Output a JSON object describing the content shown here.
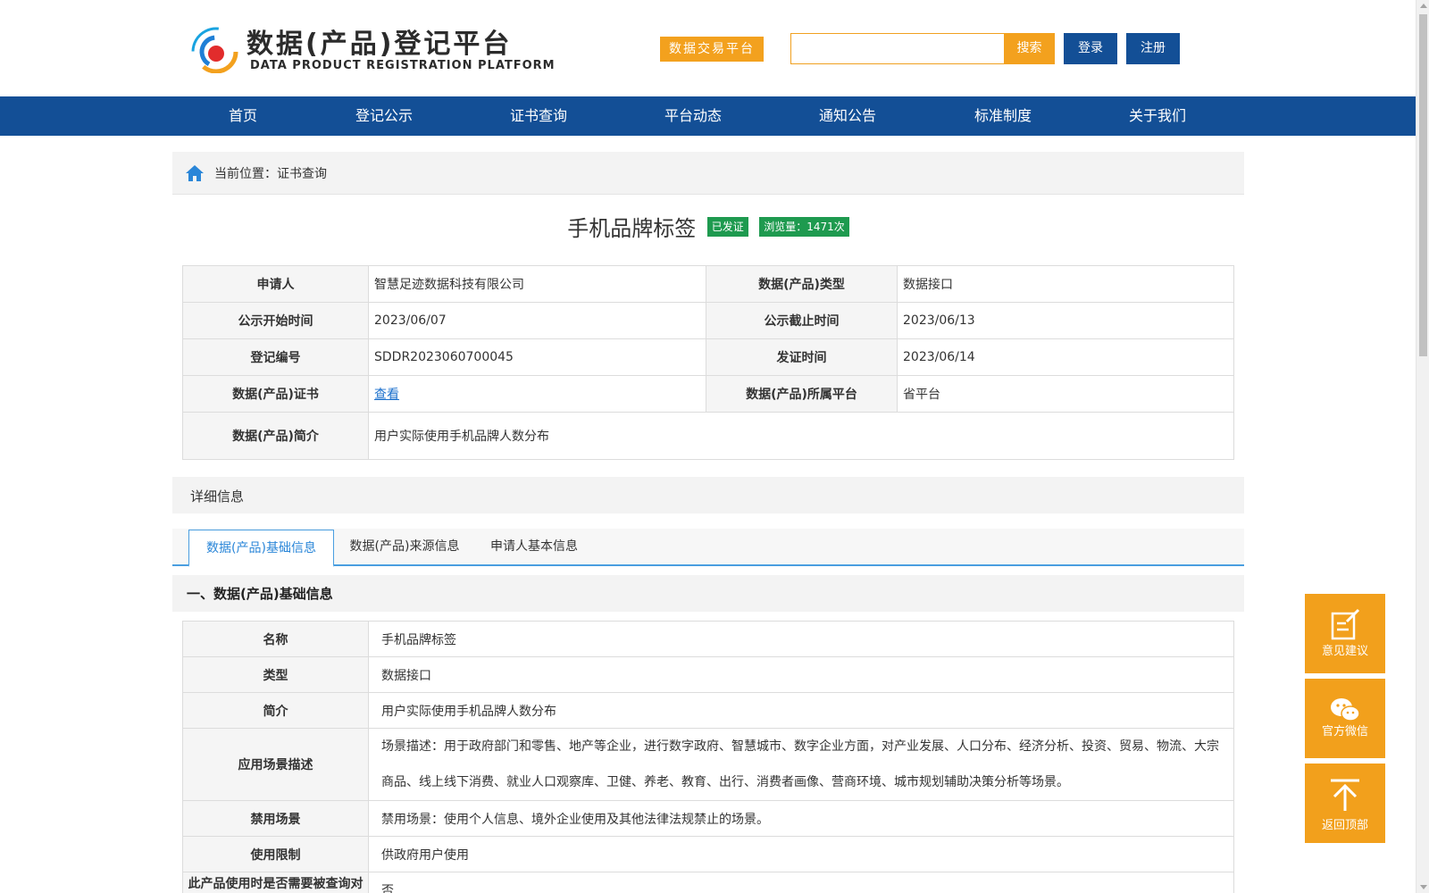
{
  "header": {
    "logo_title": "数据(产品)登记平台",
    "logo_subtitle": "DATA PRODUCT REGISTRATION PLATFORM",
    "trade_platform_label": "数据交易平台",
    "search_placeholder": "",
    "search_label": "搜索",
    "login_label": "登录",
    "register_label": "注册"
  },
  "nav": {
    "items": [
      "首页",
      "登记公示",
      "证书查询",
      "平台动态",
      "通知公告",
      "标准制度",
      "关于我们"
    ]
  },
  "breadcrumb": {
    "text": "当前位置：证书查询"
  },
  "product": {
    "title": "手机品牌标签",
    "status_badge": "已发证",
    "views_badge": "浏览量：1471次"
  },
  "info": {
    "applicant_label": "申请人",
    "applicant_value": "智慧足迹数据科技有限公司",
    "type_label": "数据(产品)类型",
    "type_value": "数据接口",
    "publicity_start_label": "公示开始时间",
    "publicity_start_value": "2023/06/07",
    "publicity_end_label": "公示截止时间",
    "publicity_end_value": "2023/06/13",
    "reg_no_label": "登记编号",
    "reg_no_value": "SDDR2023060700045",
    "issue_time_label": "发证时间",
    "issue_time_value": "2023/06/14",
    "cert_label": "数据(产品)证书",
    "cert_value": "查看",
    "platform_label": "数据(产品)所属平台",
    "platform_value": "省平台",
    "intro_label": "数据(产品)简介",
    "intro_value": "用户实际使用手机品牌人数分布"
  },
  "detail": {
    "title": "详细信息"
  },
  "tabs": [
    "数据(产品)基础信息",
    "数据(产品)来源信息",
    "申请人基本信息"
  ],
  "basic": {
    "section_title": "一、数据(产品)基础信息",
    "rows": [
      {
        "label": "名称",
        "value": "手机品牌标签"
      },
      {
        "label": "类型",
        "value": "数据接口"
      },
      {
        "label": "简介",
        "value": "用户实际使用手机品牌人数分布"
      },
      {
        "label": "应用场景描述",
        "value": "场景描述：用于政府部门和零售、地产等企业，进行数字政府、智慧城市、数字企业方面，对产业发展、人口分布、经济分析、投资、贸易、物流、大宗商品、线上线下消费、就业人口观察库、卫健、养老、教育、出行、消费者画像、营商环境、城市规划辅助决策分析等场景。"
      },
      {
        "label": "禁用场景",
        "value": "禁用场景：使用个人信息、境外企业使用及其他法律法规禁止的场景。"
      },
      {
        "label": "使用限制",
        "value": "供政府用户使用"
      },
      {
        "label": "此产品使用时是否需要被查询对",
        "value": "否"
      }
    ]
  },
  "floating": {
    "feedback_label": "意见建议",
    "wechat_label": "官方微信",
    "top_label": "返回顶部"
  },
  "colors": {
    "brand_blue": "#134f96",
    "accent_orange": "#f3a11e",
    "badge_green": "#1e9a4f",
    "tab_blue": "#2a86d8"
  }
}
